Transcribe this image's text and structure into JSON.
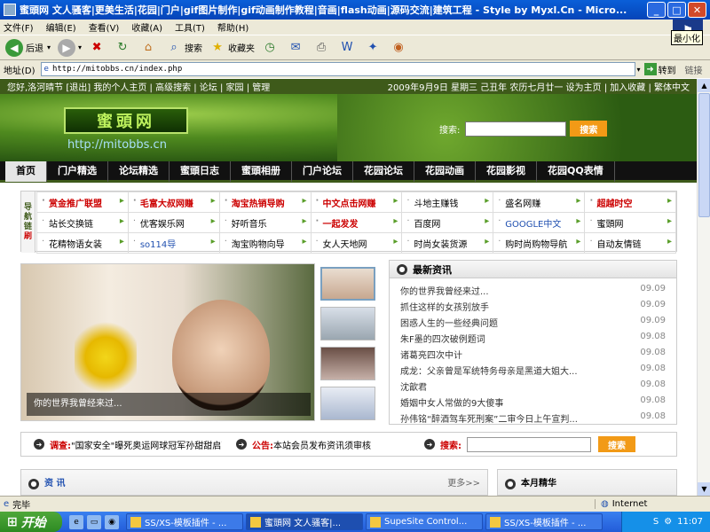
{
  "window": {
    "title": "蜜頭网 文人骚客|更美生活|花园|门户|gif图片制作|gif动画制作教程|音画|flash动画|源码交流|建筑工程 - Style by Myxl.Cn - Micro...",
    "min_tooltip": "最小化"
  },
  "menu": [
    "文件(F)",
    "编辑(E)",
    "查看(V)",
    "收藏(A)",
    "工具(T)",
    "帮助(H)"
  ],
  "toolbar": {
    "back": "后退",
    "search": "搜索",
    "favorites": "收藏夹"
  },
  "address": {
    "label": "地址(D)",
    "url": "http://mitobbs.cn/index.php",
    "go": "转到",
    "links": "链接"
  },
  "site": {
    "topstrip_left": "您好,洛河晴节 [退出] 我的个人主页 | 高级搜索 | 论坛 | 家园 | 管理",
    "topstrip_right": "2009年9月9日 星期三 己丑年 农历七月廿一 设为主页 | 加入收藏 | 繁体中文",
    "logo": "蜜頭网",
    "logo_url": "http://mitobbs.cn",
    "search_label": "搜索:",
    "search_button": "搜索",
    "nav": [
      "首页",
      "门户精选",
      "论坛精选",
      "蜜頭日志",
      "蜜頭相册",
      "门户论坛",
      "花园论坛",
      "花园动画",
      "花园影视",
      "花园QQ表情"
    ],
    "links_side": [
      "导",
      "航",
      "链",
      "刷"
    ],
    "links": [
      [
        "赏金推广联盟",
        "毛富大叔网赚",
        "淘宝热销导购",
        "中文点击网赚",
        "斗地主赚钱",
        "盛名网赚",
        "超越时空"
      ],
      [
        "站长交换链",
        "优客娱乐网",
        "好听音乐",
        "一起发发",
        "百度网",
        "GOOGLE中文",
        "蜜頭网"
      ],
      [
        "花精物语女装",
        "so114导",
        "淘宝购物向导",
        "女人天地网",
        "时尚女装货源",
        "购时尚购物导航",
        "自动友情链"
      ]
    ],
    "photo_caption": "你的世界我曾经来过...",
    "news": {
      "title": "最新资讯",
      "items": [
        {
          "t": "你的世界我曾经来过...",
          "d": "09.09"
        },
        {
          "t": "抓住这样的女孩别放手",
          "d": "09.09"
        },
        {
          "t": "困惑人生的一些经典问题",
          "d": "09.09"
        },
        {
          "t": "朱F墨的四次破例题词",
          "d": "09.08"
        },
        {
          "t": "诸葛亮四次中计",
          "d": "09.08"
        },
        {
          "t": "成龙：父亲曾是军统特务母亲是黑道大姐大...",
          "d": "09.08"
        },
        {
          "t": "沈歆君",
          "d": "09.08"
        },
        {
          "t": "婚姻中女人常做的9大傻事",
          "d": "09.08"
        },
        {
          "t": "孙伟铭“醉酒驾车死刑案”二审今日上午宣判...",
          "d": "09.08"
        }
      ]
    },
    "survey_label": "调查:",
    "survey_text": "\"国家安全\"曝死奥运网球冠军孙甜甜启蒙",
    "notice_label": "公告:",
    "notice_text": "本站会员发布资讯须审核",
    "search2_label": "搜索:",
    "search2_button": "搜索",
    "section_title": "资 讯",
    "section_more": "更多>>",
    "section2_title": "本月精华"
  },
  "status": {
    "left": "完毕",
    "zone": "Internet"
  },
  "taskbar": {
    "start": "开始",
    "tasks": [
      "SS/XS-模板插件 - ...",
      "蜜頭网 文人骚客|...",
      "SupeSite Control...",
      "SS/XS-模板插件 - ..."
    ],
    "clock": "11:07"
  }
}
